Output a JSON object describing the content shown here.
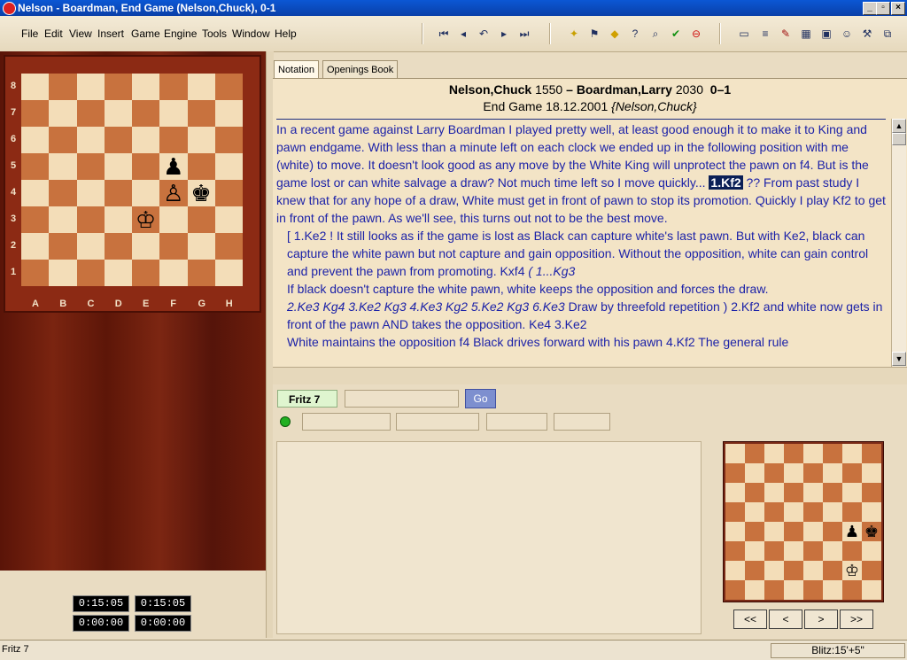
{
  "window": {
    "title": "Nelson - Boardman, End Game  (Nelson,Chuck), 0-1"
  },
  "menu": [
    "File",
    "Edit",
    "View",
    "Insert",
    "Game",
    "Engine",
    "Tools",
    "Window",
    "Help"
  ],
  "toolbar_icons": [
    "first-move-icon",
    "prev-move-icon",
    "take-back-icon",
    "next-move-icon",
    "last-move-icon",
    "new-game-icon",
    "flag-icon",
    "diamond-icon",
    "hint-icon",
    "analyze-icon",
    "accept-icon",
    "stop-icon",
    "book-icon",
    "notepad-icon",
    "pen-icon",
    "board-icon",
    "window-icon",
    "person-icon",
    "tools-icon",
    "layout-icon"
  ],
  "board": {
    "ranks": [
      "8",
      "7",
      "6",
      "5",
      "4",
      "3",
      "2",
      "1"
    ],
    "files": [
      "A",
      "B",
      "C",
      "D",
      "E",
      "F",
      "G",
      "H"
    ],
    "pieces": [
      {
        "glyph": "♟",
        "square": "f5",
        "color": "black"
      },
      {
        "glyph": "♙",
        "square": "f4",
        "color": "white"
      },
      {
        "glyph": "♚",
        "square": "g4",
        "color": "black"
      },
      {
        "glyph": "♔",
        "square": "e3",
        "color": "white"
      }
    ]
  },
  "clocks": {
    "white_time": "0:15:05",
    "black_time": "0:15:05",
    "white_used": "0:00:00",
    "black_used": "0:00:00"
  },
  "tabs": [
    "Notation",
    "Openings Book"
  ],
  "game": {
    "white": "Nelson,Chuck",
    "white_elo": "1550",
    "dash": " – ",
    "black": "Boardman,Larry",
    "black_elo": "2030",
    "result": "0–1",
    "event": "End Game",
    "date": "18.12.2001",
    "annotator": "{Nelson,Chuck}"
  },
  "notation": {
    "intro": "In a recent game against Larry Boardman I played pretty well, at least good enough it to make it to King and pawn endgame.  With less than a minute left on each clock we ended up in the following position with me (white) to move.  It doesn't look good as any move by the White King will unprotect the pawn on f4.   But is the game lost or can white salvage a draw?  Not much time left so I move quickly...",
    "move_highlight": "1.Kf2",
    "after_move": "??  From past study I knew that for any hope of a draw, White must get in front of pawn to stop its promotion.  Quickly I play Kf2 to get in front of the pawn.  As we'll see, this turns out not to be the best move.",
    "var1": "[ 1.Ke2 !  It still looks as if the game is lost as Black can capture white's last pawn.  But with Ke2, black can capture the white pawn but not capture and gain opposition.  Without the opposition, white can gain control and prevent the pawn from promoting.  Kxf4",
    "var1_italic": "  ( 1...Kg3",
    "var2": "If black doesn't capture the white pawn,  white keeps the opposition and forces the draw.",
    "var3_italic": "2.Ke3  Kg4  3.Ke2  Kg3  4.Ke3  Kg2  5.Ke2  Kg3  6.Ke3",
    "var3_rest": " Draw by threefold repetition ) 2.Kf2 and white now gets in front of the pawn AND takes the opposition.  Ke4  3.Ke2",
    "var4": "White maintains the opposition  f4 Black drives forward with his pawn  4.Kf2 The general rule"
  },
  "engine": {
    "name": "Fritz 7",
    "go_label": "Go"
  },
  "mini_board_pieces": [
    {
      "glyph": "♟",
      "square": "g4"
    },
    {
      "glyph": "♚",
      "square": "h4"
    },
    {
      "glyph": "♔",
      "square": "g2"
    }
  ],
  "nav_buttons": [
    "<<",
    "<",
    ">",
    ">>"
  ],
  "status": {
    "left": "Fritz 7",
    "right": "Blitz:15'+5\""
  }
}
